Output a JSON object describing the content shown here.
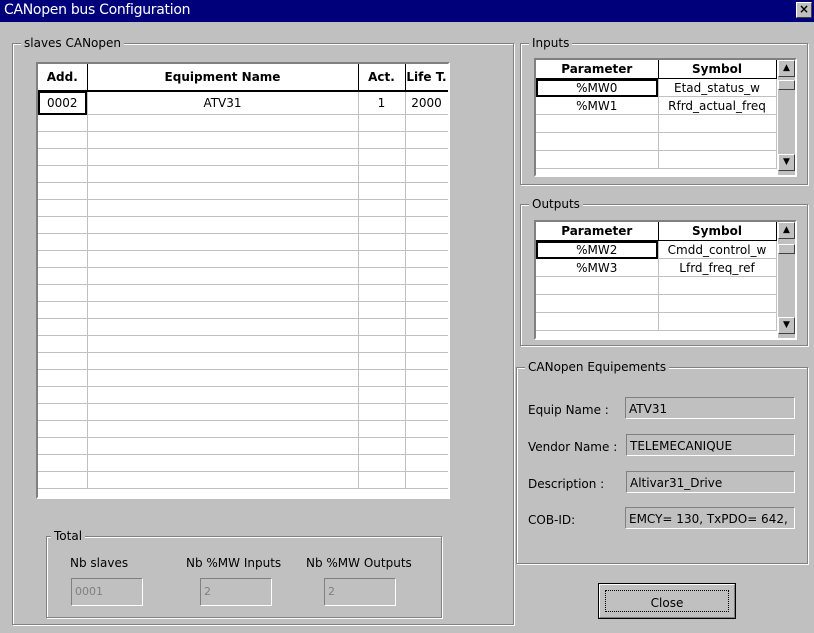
{
  "window": {
    "title": "CANopen bus Configuration",
    "close_glyph": "×",
    "close_icon": "close-icon"
  },
  "slaves": {
    "legend": "slaves CANopen",
    "columns": [
      "Add.",
      "Equipment Name",
      "Act.",
      "Life T."
    ],
    "rows": [
      [
        "0002",
        "ATV31",
        "1",
        "2000"
      ]
    ]
  },
  "total": {
    "legend": "Total",
    "nb_slaves_label": "Nb slaves",
    "nb_inputs_label": "Nb %MW Inputs",
    "nb_outputs_label": "Nb %MW Outputs",
    "nb_slaves_value": "0001",
    "nb_inputs_value": "2",
    "nb_outputs_value": "2"
  },
  "inputs": {
    "legend": "Inputs",
    "columns": [
      "Parameter",
      "Symbol"
    ],
    "rows": [
      [
        "%MW0",
        "Etad_status_w"
      ],
      [
        "%MW1",
        "Rfrd_actual_freq"
      ]
    ],
    "scroll_up_icon": "▲",
    "scroll_down_icon": "▼"
  },
  "outputs": {
    "legend": "Outputs",
    "columns": [
      "Parameter",
      "Symbol"
    ],
    "rows": [
      [
        "%MW2",
        "Cmdd_control_w"
      ],
      [
        "%MW3",
        "Lfrd_freq_ref"
      ]
    ],
    "scroll_up_icon": "▲",
    "scroll_down_icon": "▼"
  },
  "equipements": {
    "legend": "CANopen Equipements",
    "equip_name_label": "Equip Name :",
    "equip_name_value": "ATV31",
    "vendor_name_label": "Vendor Name :",
    "vendor_name_value": "TELEMECANIQUE",
    "description_label": "Description :",
    "description_value": "Altivar31_Drive",
    "cobid_label": "COB-ID:",
    "cobid_value": "EMCY= 130, TxPDO= 642,"
  },
  "buttons": {
    "close_label": "Close"
  }
}
